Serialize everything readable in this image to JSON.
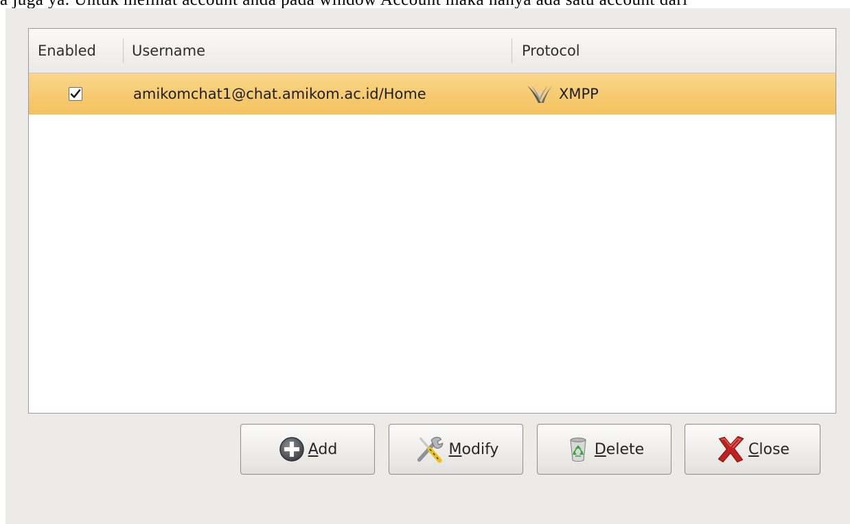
{
  "caption": {
    "text": "a juga ya. Untuk melihat account anda pada window Account maka hanya ada satu account dari"
  },
  "accounts": {
    "columns": {
      "enabled": "Enabled",
      "username": "Username",
      "protocol": "Protocol"
    },
    "rows": [
      {
        "enabled": true,
        "username": "amikomchat1@chat.amikom.ac.id/Home",
        "protocol": "XMPP"
      }
    ],
    "selected_row_color": "#f4c15e"
  },
  "buttons": {
    "add": {
      "mnemonic": "A",
      "rest": "dd",
      "icon": "add-circle-icon"
    },
    "modify": {
      "mnemonic": "M",
      "rest": "odify",
      "icon": "wrench-screwdriver-icon"
    },
    "delete": {
      "mnemonic": "D",
      "rest": "elete",
      "icon": "recycle-bin-icon"
    },
    "close": {
      "mnemonic": "C",
      "rest": "lose",
      "icon": "red-x-icon"
    }
  }
}
